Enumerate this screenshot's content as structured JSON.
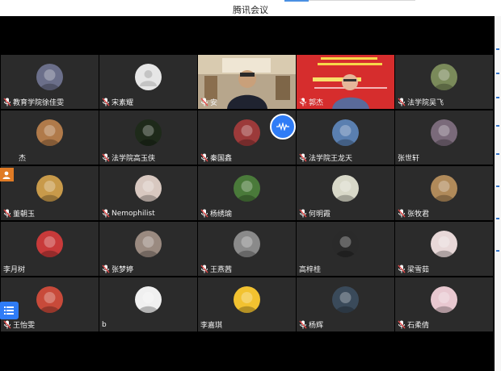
{
  "window": {
    "title": "腾讯会议"
  },
  "colors": {
    "stage": "#000000",
    "tile": "#2b2b2b",
    "accent": "#2f7cf6",
    "mic_off": "#e24c4c",
    "screen_share": "#e07b25"
  },
  "participants": [
    {
      "name": "教育学院徐佳雯",
      "mic": "muted-icon",
      "avatar": "anime-girl-avatar",
      "bg": "#6b6f8a"
    },
    {
      "name": "宋素耀",
      "mic": "muted-icon",
      "avatar": "default-user-avatar",
      "bg": "#e4e4e4"
    },
    {
      "name": "安",
      "mic": "muted-icon",
      "avatar": "camera-video-man",
      "bg": "#b5a48a"
    },
    {
      "name": "郭杰",
      "mic": "muted-icon",
      "avatar": "camera-video-speaker-red-banner",
      "bg": "#d42e2e"
    },
    {
      "name": "法学院吴飞",
      "mic": "muted-icon",
      "avatar": "man-photo-avatar",
      "bg": "#7a8a5a"
    },
    {
      "name": "杰",
      "mic": "screen-share-icon",
      "avatar": "dog-avatar",
      "bg": "#b07a4a"
    },
    {
      "name": "法学院高玉侠",
      "mic": "muted-icon",
      "avatar": "flower-avatar",
      "bg": "#1e2a1a"
    },
    {
      "name": "秦国鑫",
      "mic": "muted-icon",
      "avatar": "sunset-avatar",
      "bg": "#9c3a3a"
    },
    {
      "name": "法学院王龙天",
      "mic": "muted-icon",
      "avatar": "city-skyline-avatar",
      "bg": "#5a7fb0"
    },
    {
      "name": "张世轩",
      "mic": "none",
      "avatar": "evening-sky-avatar",
      "bg": "#7a6a7a"
    },
    {
      "name": "董朝玉",
      "mic": "muted-icon",
      "avatar": "dogs-avatar",
      "bg": "#c89a4a"
    },
    {
      "name": "Nemophilist",
      "mic": "muted-icon",
      "avatar": "girl-photo-avatar",
      "bg": "#d8c8c0"
    },
    {
      "name": "杨绣瑜",
      "mic": "muted-icon",
      "avatar": "cartoon-bird-avatar",
      "bg": "#4a7a3a"
    },
    {
      "name": "何明霞",
      "mic": "muted-icon",
      "avatar": "cartoon-girl-avatar",
      "bg": "#d8d8c8"
    },
    {
      "name": "张牧君",
      "mic": "muted-icon",
      "avatar": "tiger-plush-avatar",
      "bg": "#b08a5a"
    },
    {
      "name": "李月树",
      "mic": "none",
      "avatar": "red-scarf-avatar",
      "bg": "#c83a3a"
    },
    {
      "name": "张梦婷",
      "mic": "muted-icon",
      "avatar": "portrait-avatar",
      "bg": "#9a8a80"
    },
    {
      "name": "王燕茜",
      "mic": "muted-icon",
      "avatar": "bw-girl-avatar",
      "bg": "#8a8a8a"
    },
    {
      "name": "高梓桂",
      "mic": "none",
      "avatar": "panda-face-avatar",
      "bg": "#2a2a2a"
    },
    {
      "name": "梁雪茹",
      "mic": "muted-icon",
      "avatar": "anime-red-avatar",
      "bg": "#e8d8d8"
    },
    {
      "name": "王怡雯",
      "mic": "muted-icon",
      "avatar": "red-hair-girl-avatar",
      "bg": "#c84a3a"
    },
    {
      "name": "b",
      "mic": "none",
      "avatar": "sketch-avatar",
      "bg": "#f0f0f0"
    },
    {
      "name": "李嘉琪",
      "mic": "none",
      "avatar": "yellow-character-avatar",
      "bg": "#f2c230"
    },
    {
      "name": "杨辉",
      "mic": "muted-icon",
      "avatar": "dark-figure-avatar",
      "bg": "#3a4a5a"
    },
    {
      "name": "石柔倩",
      "mic": "muted-icon",
      "avatar": "pink-toy-avatar",
      "bg": "#e8c8d0"
    }
  ]
}
